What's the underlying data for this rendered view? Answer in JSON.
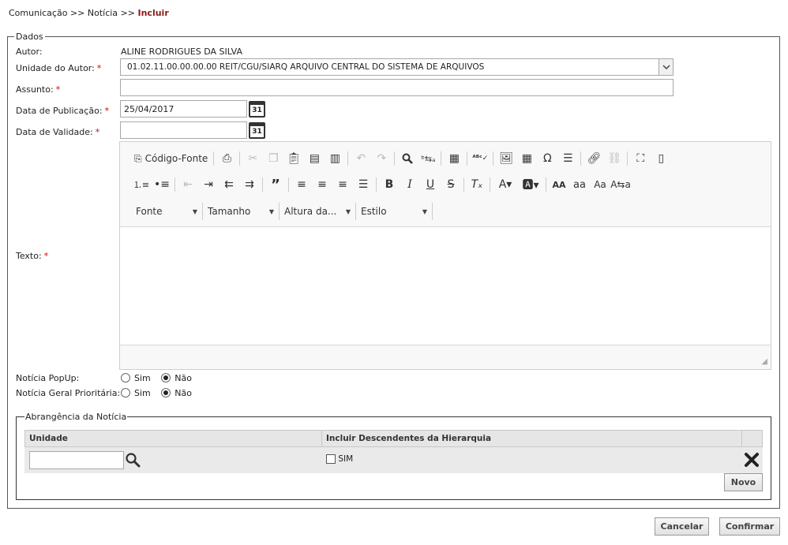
{
  "breadcrumb": {
    "part1": "Comunicação",
    "sep1": ">>",
    "part2": "Notícia",
    "sep2": ">>",
    "current": "Incluir"
  },
  "dados": {
    "legend": "Dados",
    "autor_label": "Autor:",
    "autor_value": "ALINE RODRIGUES DA SILVA",
    "unidade_label": "Unidade do Autor:",
    "unidade_value": "01.02.11.00.00.00.00 REIT/CGU/SIARQ ARQUIVO CENTRAL DO SISTEMA DE ARQUIVOS",
    "assunto_label": "Assunto:",
    "assunto_value": "",
    "data_pub_label": "Data de Publicação:",
    "data_pub_value": "25/04/2017",
    "data_val_label": "Data de Validade:",
    "data_val_value": "",
    "calendar_day": "31",
    "texto_label": "Texto:",
    "required_mark": "*"
  },
  "editor": {
    "source_label": "Código-Fonte",
    "font_label": "Fonte",
    "size_label": "Tamanho",
    "height_label": "Altura da...",
    "style_label": "Estilo"
  },
  "options": {
    "popup_label": "Notícia PopUp:",
    "geral_label": "Notícia Geral Prioritária:",
    "sim": "Sim",
    "nao": "Não",
    "popup_selected": "Não",
    "geral_selected": "Não"
  },
  "abrangencia": {
    "legend": "Abrangência da Notícia",
    "col_unidade": "Unidade",
    "col_incluir": "Incluir Descendentes da Hierarquia",
    "checkbox_label": "SIM",
    "unidade_value": "",
    "novo_label": "Novo"
  },
  "actions": {
    "cancelar": "Cancelar",
    "confirmar": "Confirmar"
  }
}
